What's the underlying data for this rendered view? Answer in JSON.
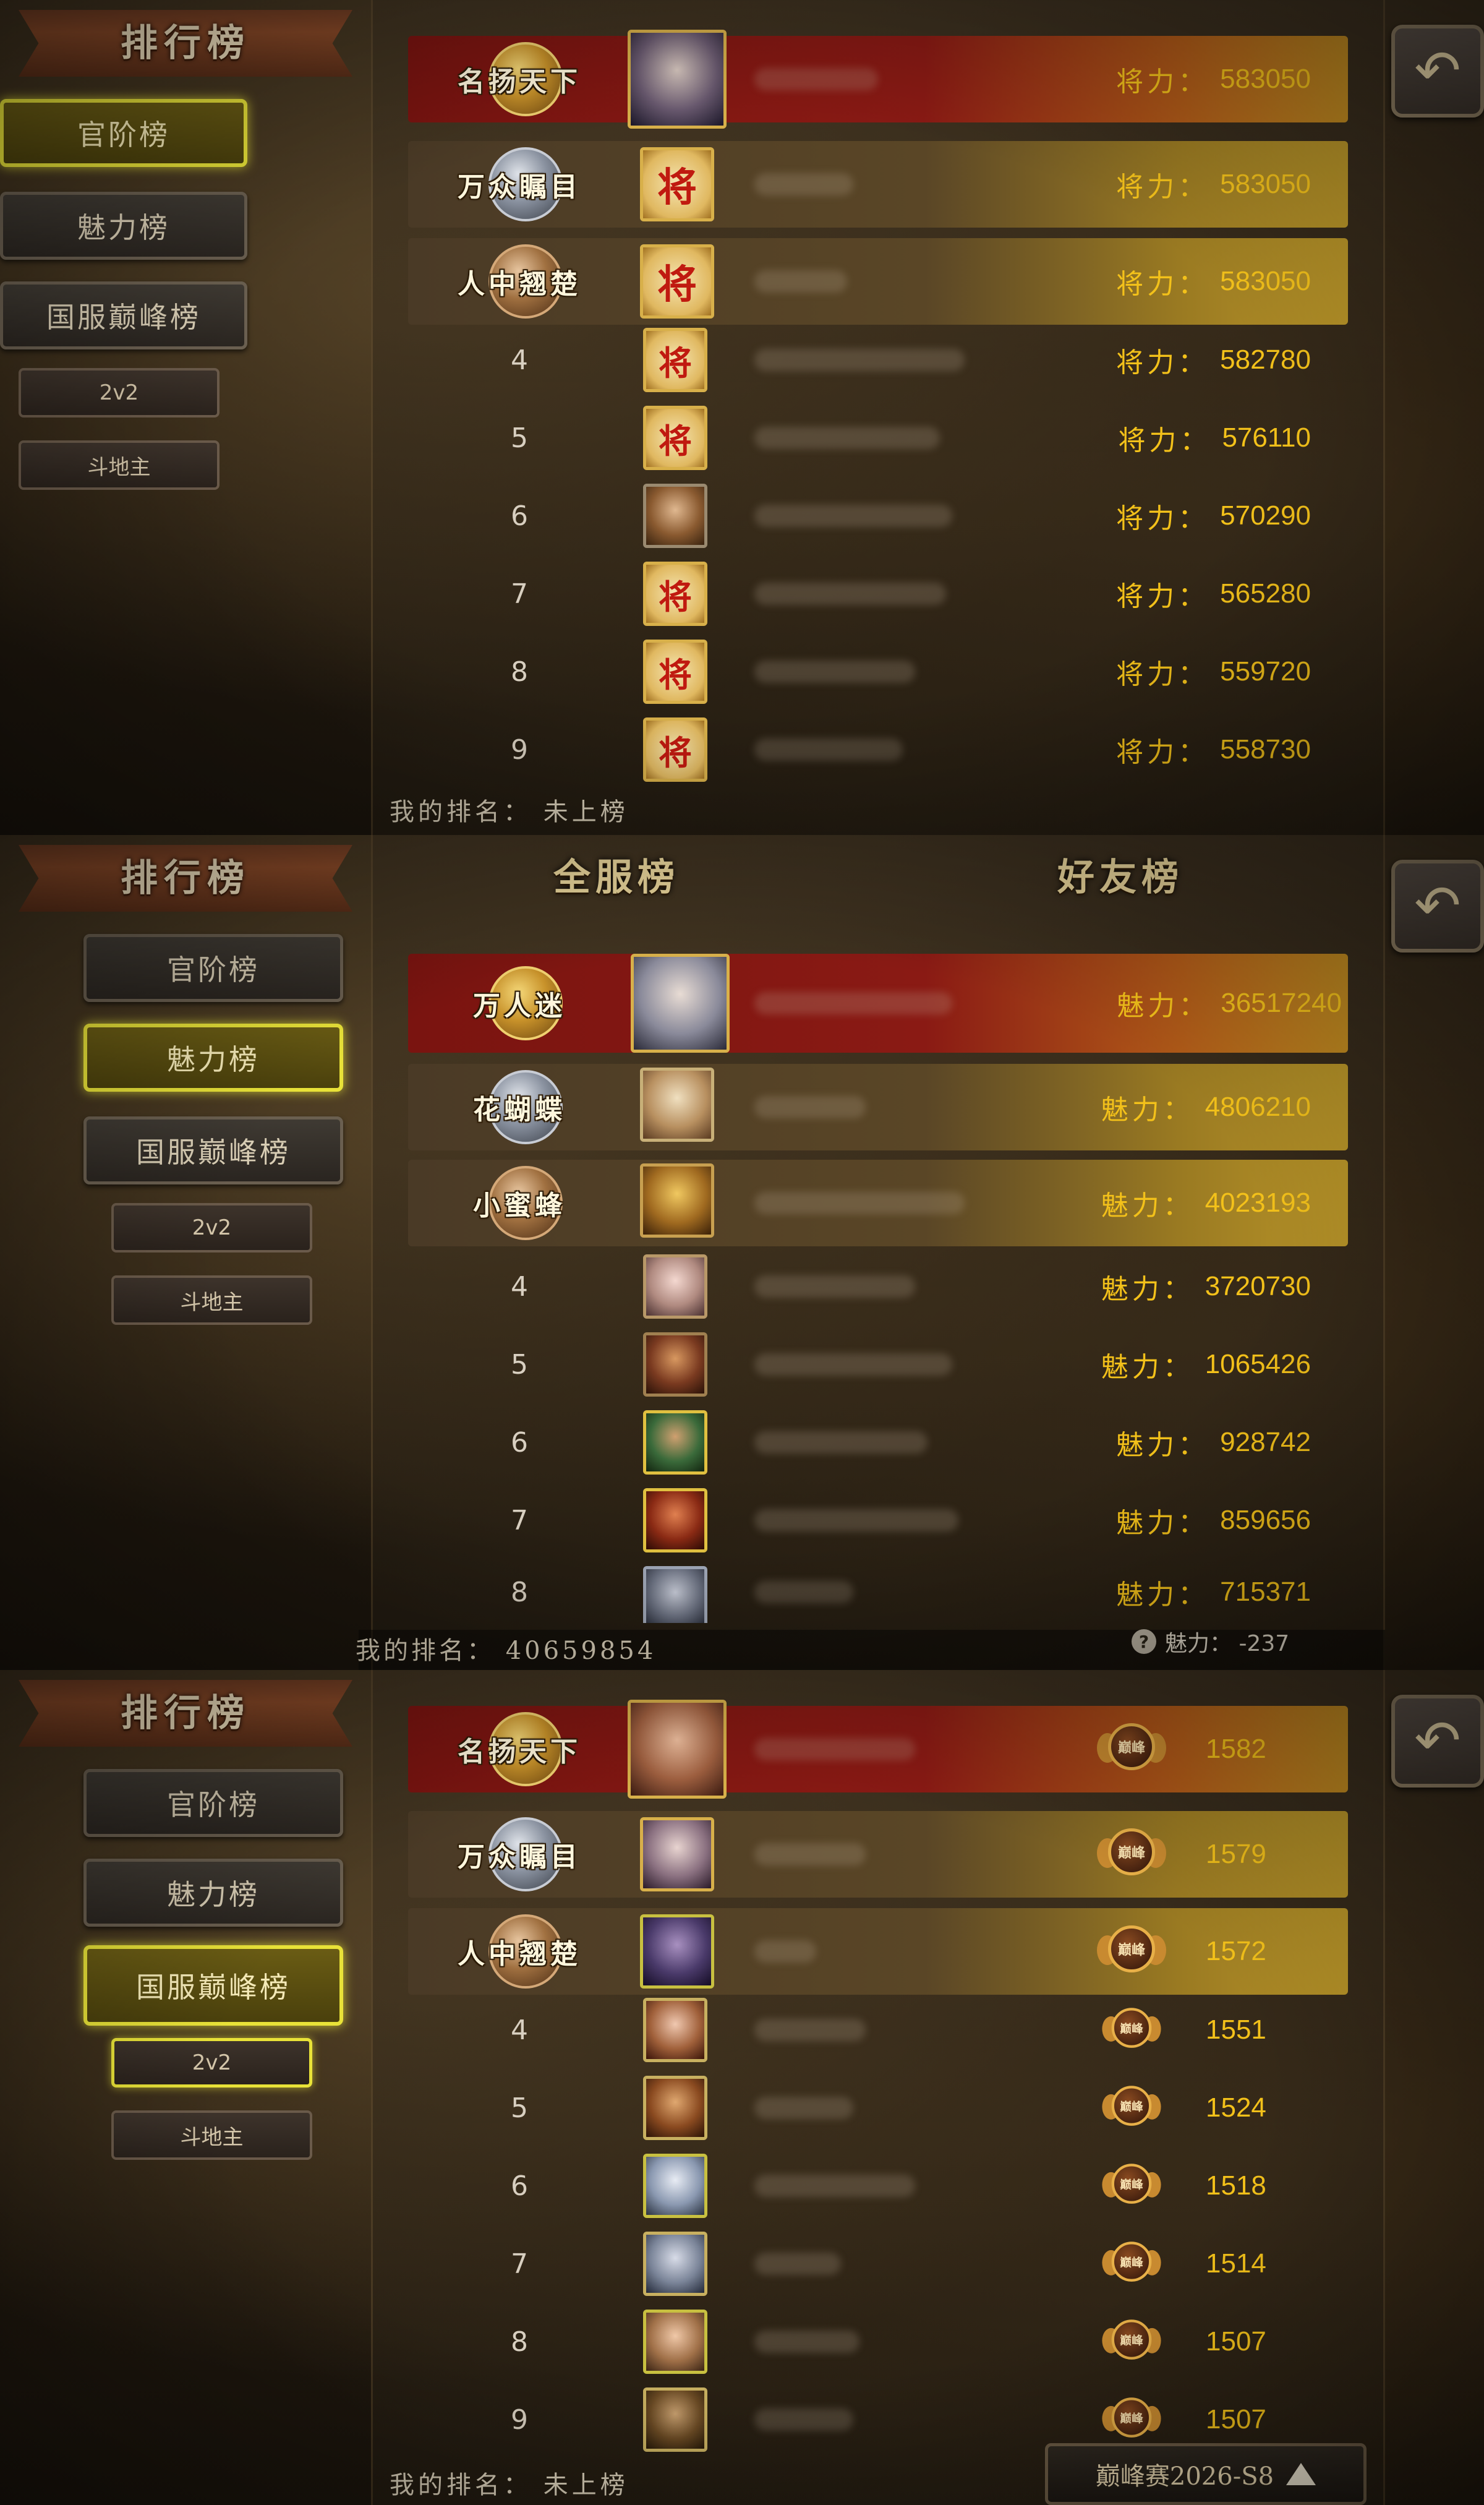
{
  "title": "排行榜",
  "back_icon": "back-arrow-icon",
  "nav": {
    "official": "官阶榜",
    "charm": "魅力榜",
    "peak": "国服巅峰榜",
    "v2": "2v2",
    "landlord": "斗地主"
  },
  "panel1": {
    "stat_label": "将力：",
    "my_rank": "我的排名：  未上榜",
    "top": [
      {
        "title": "名扬天下",
        "value": "583050"
      },
      {
        "title": "万众瞩目",
        "value": "583050"
      },
      {
        "title": "人中翘楚",
        "value": "583050"
      }
    ],
    "rows": [
      {
        "rank": "4",
        "value": "582780",
        "avatar": "jiang"
      },
      {
        "rank": "5",
        "value": "576110",
        "avatar": "jiang"
      },
      {
        "rank": "6",
        "value": "570290",
        "avatar": "hero"
      },
      {
        "rank": "7",
        "value": "565280",
        "avatar": "jiang"
      },
      {
        "rank": "8",
        "value": "559720",
        "avatar": "jiang"
      },
      {
        "rank": "9",
        "value": "558730",
        "avatar": "jiang"
      }
    ],
    "jiang_char": "将"
  },
  "panel2": {
    "tab_all": "全服榜",
    "tab_friends": "好友榜",
    "stat_label": "魅力：",
    "my_rank": "我的排名：  40659854",
    "my_charm": "魅力：  -237",
    "top": [
      {
        "title": "万人迷",
        "value": "36517240"
      },
      {
        "title": "花蝴蝶",
        "value": "4806210"
      },
      {
        "title": "小蜜蜂",
        "value": "4023193"
      }
    ],
    "rows": [
      {
        "rank": "4",
        "value": "3720730"
      },
      {
        "rank": "5",
        "value": "1065426"
      },
      {
        "rank": "6",
        "value": "928742"
      },
      {
        "rank": "7",
        "value": "859656"
      },
      {
        "rank": "8",
        "value": "715371"
      }
    ]
  },
  "panel3": {
    "my_rank": "我的排名：  未上榜",
    "season": "巅峰赛2026-S8",
    "emblem_text": "巅峰",
    "top": [
      {
        "title": "名扬天下",
        "value": "1582"
      },
      {
        "title": "万众瞩目",
        "value": "1579"
      },
      {
        "title": "人中翘楚",
        "value": "1572"
      }
    ],
    "rows": [
      {
        "rank": "4",
        "value": "1551"
      },
      {
        "rank": "5",
        "value": "1524"
      },
      {
        "rank": "6",
        "value": "1518"
      },
      {
        "rank": "7",
        "value": "1514"
      },
      {
        "rank": "8",
        "value": "1507"
      },
      {
        "rank": "9",
        "value": "1507"
      }
    ]
  },
  "colors": {
    "accent_yellow": "#f3c11a",
    "active_border": "#e8e238",
    "rank1_red": "#8a1a14"
  }
}
